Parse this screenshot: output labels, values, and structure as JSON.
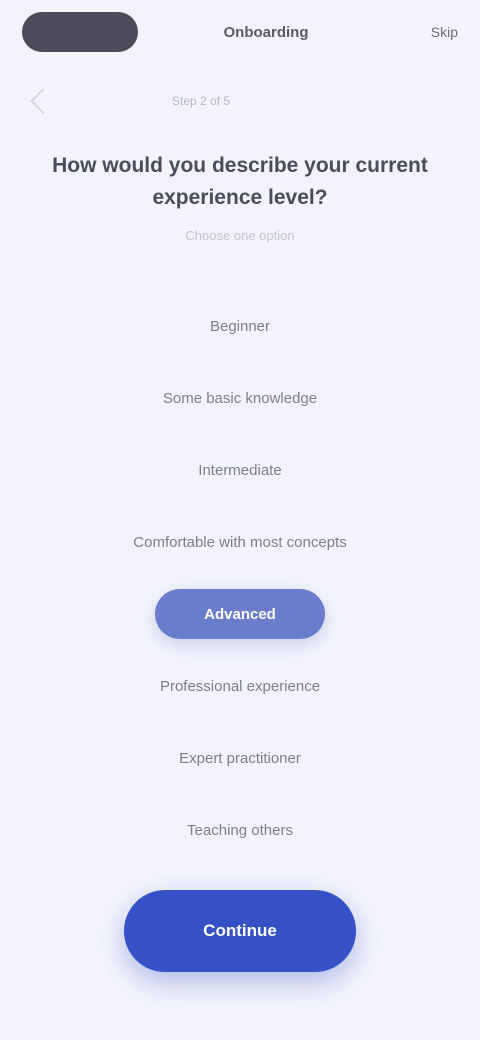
{
  "topbar": {
    "title": "Onboarding",
    "right_label": "Skip"
  },
  "subrow": {
    "label": "Step 2 of 5"
  },
  "heading": {
    "title": "How would you describe your current experience level?",
    "subtitle": "Choose one option"
  },
  "options": [
    {
      "label": "Beginner",
      "selected": false
    },
    {
      "label": "Some basic knowledge",
      "selected": false
    },
    {
      "label": "Intermediate",
      "selected": false
    },
    {
      "label": "Comfortable with most concepts",
      "selected": false
    },
    {
      "label": "Advanced",
      "selected": true
    },
    {
      "label": "Professional experience",
      "selected": false
    },
    {
      "label": "Expert practitioner",
      "selected": false
    },
    {
      "label": "Teaching others",
      "selected": false
    }
  ],
  "cta": {
    "label": "Continue"
  },
  "colors": {
    "background": "#f3f4fb",
    "accent": "#3551c5",
    "selected": "#6a7dcc",
    "dark_pill": "#4a4a58"
  }
}
